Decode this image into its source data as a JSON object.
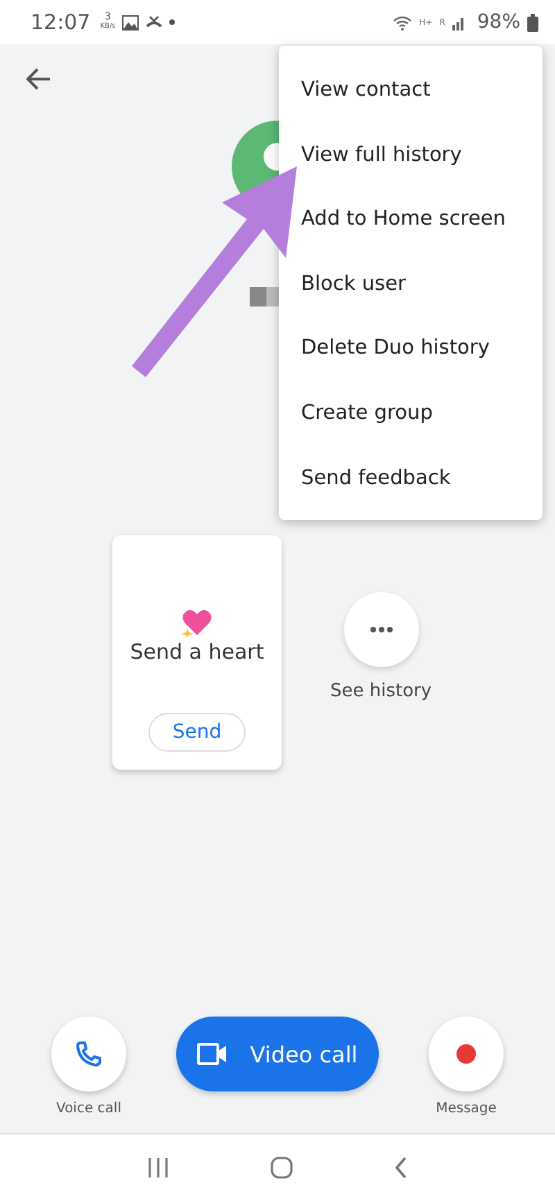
{
  "status_bar": {
    "time": "12:07",
    "speed_value": "3",
    "speed_unit": "KB/s",
    "network_labels": [
      "H+",
      "R"
    ],
    "battery": "98%"
  },
  "menu": {
    "items": [
      "View contact",
      "View full history",
      "Add to Home screen",
      "Block user",
      "Delete Duo history",
      "Create group",
      "Send feedback"
    ]
  },
  "heart_card": {
    "title": "Send a heart",
    "button": "Send"
  },
  "history": {
    "label": "See history"
  },
  "actions": [
    {
      "kind": "voice",
      "label": "Voice call"
    },
    {
      "kind": "video",
      "label": "Video call"
    },
    {
      "kind": "message",
      "label": "Message"
    }
  ]
}
